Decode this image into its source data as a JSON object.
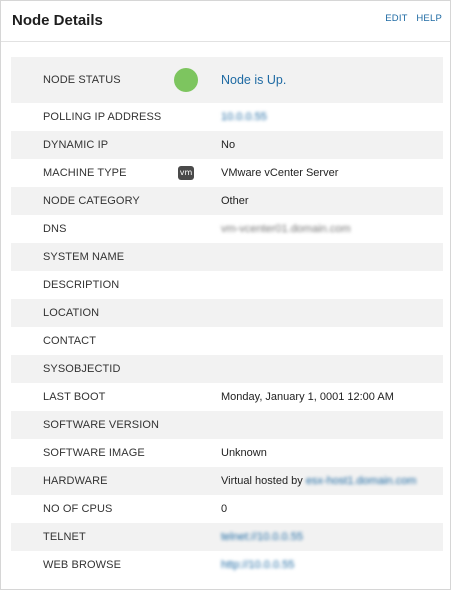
{
  "header": {
    "title": "Node Details",
    "edit_label": "EDIT",
    "help_label": "HELP"
  },
  "rows": [
    {
      "label": "NODE STATUS",
      "value": "Node is Up."
    },
    {
      "label": "POLLING IP ADDRESS",
      "value": "10.0.0.55"
    },
    {
      "label": "DYNAMIC IP",
      "value": "No"
    },
    {
      "label": "MACHINE TYPE",
      "value": "VMware vCenter Server",
      "icon_text": "vm"
    },
    {
      "label": "NODE CATEGORY",
      "value": "Other"
    },
    {
      "label": "DNS",
      "value": "vm-vcenter01.domain.com"
    },
    {
      "label": "SYSTEM NAME",
      "value": ""
    },
    {
      "label": "DESCRIPTION",
      "value": ""
    },
    {
      "label": "LOCATION",
      "value": ""
    },
    {
      "label": "CONTACT",
      "value": ""
    },
    {
      "label": "SYSOBJECTID",
      "value": ""
    },
    {
      "label": "LAST BOOT",
      "value": "Monday, January 1, 0001 12:00 AM"
    },
    {
      "label": "SOFTWARE VERSION",
      "value": ""
    },
    {
      "label": "SOFTWARE IMAGE",
      "value": "Unknown"
    },
    {
      "label": "HARDWARE",
      "value_prefix": "Virtual hosted by",
      "value_link": "esx-host1.domain.com"
    },
    {
      "label": "NO OF CPUS",
      "value": "0"
    },
    {
      "label": "TELNET",
      "value": "telnet://10.0.0.55"
    },
    {
      "label": "WEB BROWSE",
      "value": "http://10.0.0.55"
    }
  ],
  "colors": {
    "status_up": "#7dc55f",
    "link": "#1e6aa3",
    "row_alt": "#f2f2f2"
  },
  "icons": {
    "status": "status-up-dot-icon",
    "machine_type": "vmware-icon"
  }
}
